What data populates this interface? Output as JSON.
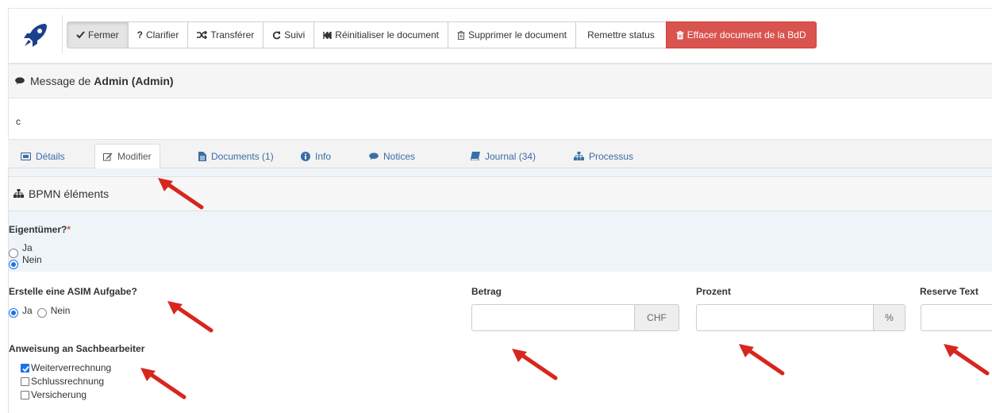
{
  "toolbar": {
    "buttons": [
      {
        "label": "Fermer",
        "icon": "check-icon"
      },
      {
        "label": "Clarifier",
        "icon": "question-icon"
      },
      {
        "label": "Transférer",
        "icon": "shuffle-icon"
      },
      {
        "label": "Suivi",
        "icon": "refresh-icon"
      },
      {
        "label": "Réinitialiser le document",
        "icon": "fast-backward-icon"
      },
      {
        "label": "Supprimer le document",
        "icon": "trash-icon"
      },
      {
        "label": "Remettre status",
        "icon": ""
      },
      {
        "label": "Effacer document de la BdD",
        "icon": "trash-icon"
      }
    ],
    "danger_color": "#d9534f"
  },
  "message": {
    "prefix": "Message de",
    "author": "Admin (Admin)",
    "body": "c"
  },
  "tabs": [
    {
      "label": "Détails",
      "icon": "id-card-icon"
    },
    {
      "label": "Modifier",
      "icon": "edit-icon"
    },
    {
      "label": "Documents (1)",
      "icon": "file-icon"
    },
    {
      "label": "Info",
      "icon": "info-icon"
    },
    {
      "label": "Notices",
      "icon": "comment-icon"
    },
    {
      "label": "Journal (34)",
      "icon": "book-icon"
    },
    {
      "label": "Processus",
      "icon": "sitemap-icon"
    }
  ],
  "bpmn": {
    "title": "BPMN éléments",
    "eigentumer": {
      "label": "Eigentümer?",
      "required_mark": "*",
      "options": [
        "Ja",
        "Nein"
      ],
      "selected": "Nein"
    },
    "asim": {
      "label": "Erstelle eine ASIM Aufgabe?",
      "options": [
        "Ja",
        "Nein"
      ],
      "selected": "Ja"
    },
    "betrag": {
      "label": "Betrag",
      "value": "",
      "unit": "CHF"
    },
    "prozent": {
      "label": "Prozent",
      "value": "",
      "unit": "%"
    },
    "reserve": {
      "label": "Reserve Text",
      "value": ""
    },
    "anweisung": {
      "label": "Anweisung an Sachbearbeiter",
      "options": [
        {
          "label": "Weiterverrechnung",
          "checked": true
        },
        {
          "label": "Schlussrechnung",
          "checked": false
        },
        {
          "label": "Versicherung",
          "checked": false
        }
      ]
    }
  },
  "annotation_color": "#d7261e"
}
